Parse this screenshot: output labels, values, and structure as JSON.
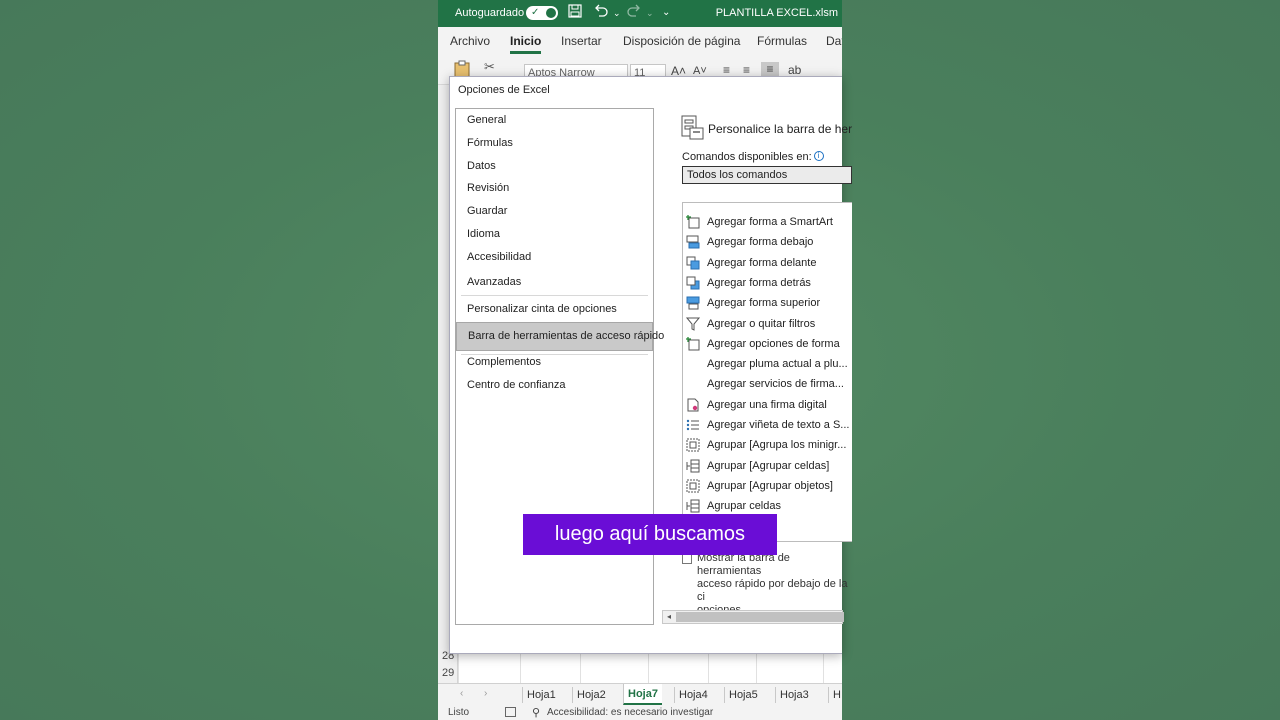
{
  "titlebar": {
    "autosave_label": "Autoguardado",
    "filename": "PLANTILLA EXCEL.xlsm"
  },
  "ribbon": {
    "tabs": [
      "Archivo",
      "Inicio",
      "Insertar",
      "Disposición de página",
      "Fórmulas",
      "Dat"
    ],
    "active_tab": "Inicio",
    "font_name": "Aptos Narrow",
    "font_size": "11"
  },
  "sheet": {
    "row_numbers": [
      "28",
      "29"
    ]
  },
  "sheet_tabs": [
    "Hoja1",
    "Hoja2",
    "Hoja7",
    "Hoja4",
    "Hoja5",
    "Hoja3",
    "H"
  ],
  "active_sheet": "Hoja7",
  "statusbar": {
    "ready": "Listo",
    "accessibility": "Accesibilidad: es necesario investigar"
  },
  "dialog": {
    "title": "Opciones de Excel",
    "nav": [
      "General",
      "Fórmulas",
      "Datos",
      "Revisión",
      "Guardar",
      "Idioma",
      "Accesibilidad",
      "Avanzadas",
      "Personalizar cinta de opciones",
      "Barra de herramientas de acceso rápido",
      "Complementos",
      "Centro de confianza"
    ],
    "selected_nav": "Barra de herramientas de acceso rápido",
    "heading": "Personalice la barra de her",
    "commands_label": "Comandos disponibles en:",
    "commands_selected": "Todos los comandos",
    "commands": [
      {
        "label": "Agregar forma a SmartArt",
        "icon": "add-shape-icon"
      },
      {
        "label": "Agregar forma debajo",
        "icon": "shape-below-icon"
      },
      {
        "label": "Agregar forma delante",
        "icon": "shape-front-icon"
      },
      {
        "label": "Agregar forma detrás",
        "icon": "shape-behind-icon"
      },
      {
        "label": "Agregar forma superior",
        "icon": "shape-above-icon"
      },
      {
        "label": "Agregar o quitar filtros",
        "icon": "filter-icon"
      },
      {
        "label": "Agregar opciones de forma",
        "icon": "add-shape-icon"
      },
      {
        "label": "Agregar pluma actual a plu...",
        "icon": ""
      },
      {
        "label": "Agregar servicios de firma...",
        "icon": ""
      },
      {
        "label": "Agregar una firma digital",
        "icon": "signature-icon"
      },
      {
        "label": "Agregar viñeta de texto a S...",
        "icon": "bullet-list-icon"
      },
      {
        "label": "Agrupar [Agrupa los minigr...",
        "icon": "group-icon"
      },
      {
        "label": "Agrupar [Agrupar celdas]",
        "icon": "group-cells-icon"
      },
      {
        "label": "Agrupar [Agrupar objetos]",
        "icon": "group-icon"
      },
      {
        "label": "Agrupar celdas",
        "icon": "group-cells-icon"
      }
    ],
    "show_below_text": "Mostrar la barra de herramientas\nacceso rápido por debajo de la ci\nopciones"
  },
  "caption": "luego aquí buscamos",
  "colors": {
    "excel_green": "#217346",
    "background": "#4a7f5c",
    "caption_bg": "#6a0dd6"
  }
}
